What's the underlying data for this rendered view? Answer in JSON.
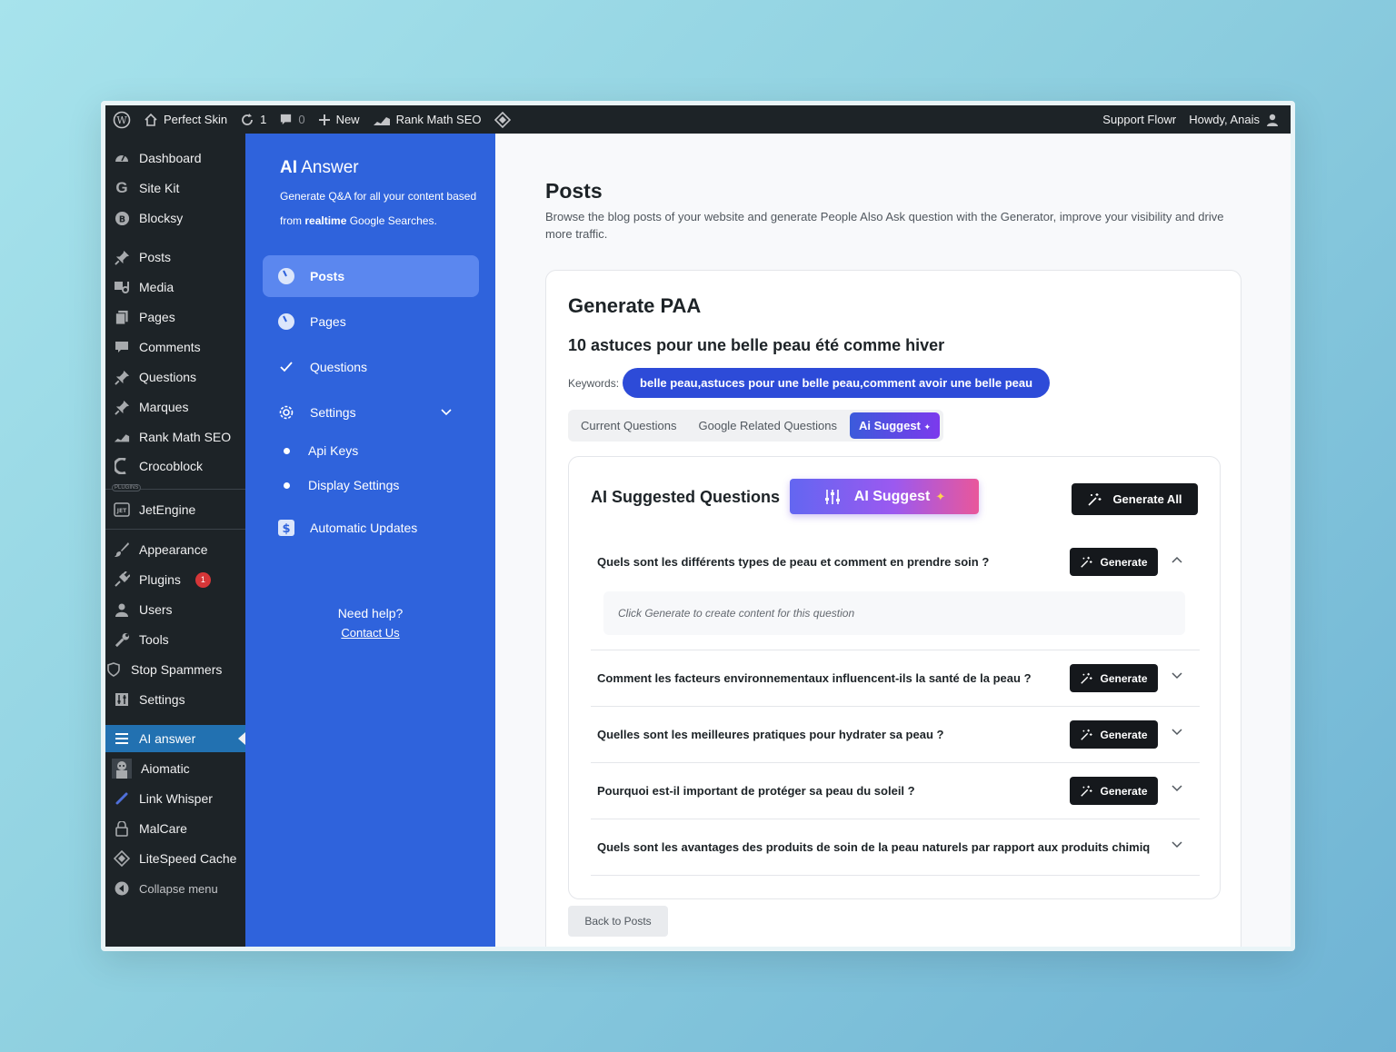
{
  "adminbar": {
    "site_name": "Perfect Skin",
    "updates_count": "1",
    "comments_count": "0",
    "new_label": "New",
    "rankmath_label": "Rank Math SEO",
    "support_label": "Support Flowr",
    "howdy_label": "Howdy, Anais"
  },
  "wp_menu": {
    "dashboard": "Dashboard",
    "site_kit": "Site Kit",
    "blocksy": "Blocksy",
    "posts": "Posts",
    "media": "Media",
    "pages": "Pages",
    "comments": "Comments",
    "questions": "Questions",
    "marques": "Marques",
    "rank_math": "Rank Math SEO",
    "crocoblock": "Crocoblock",
    "plugins_tag": "PLUGINS",
    "jetengine": "JetEngine",
    "appearance": "Appearance",
    "plugins": "Plugins",
    "plugins_badge": "1",
    "users": "Users",
    "tools": "Tools",
    "stop_spammers": "Stop Spammers",
    "settings": "Settings",
    "ai_answer": "AI answer",
    "aiomatic": "Aiomatic",
    "link_whisper": "Link Whisper",
    "malcare": "MalCare",
    "litespeed": "LiteSpeed Cache",
    "collapse": "Collapse menu"
  },
  "plugin_side": {
    "title_ai": "AI",
    "title_rest": "Answer",
    "desc_part1": "Generate Q&A for all your content based from",
    "desc_bold": "realtime",
    "desc_part2": "Google Searches.",
    "posts": "Posts",
    "pages": "Pages",
    "questions": "Questions",
    "settings": "Settings",
    "api_keys": "Api Keys",
    "display_settings": "Display Settings",
    "automatic_updates": "Automatic Updates",
    "need_help": "Need help?",
    "contact": "Contact Us"
  },
  "main": {
    "title": "Posts",
    "description": "Browse the blog posts of your website and generate People Also Ask question with the Generator, improve your visibility and drive more traffic.",
    "card_title": "Generate PAA",
    "post_title": "10 astuces pour une belle peau été comme hiver",
    "keywords_label": "Keywords:",
    "keywords_value": "belle peau,astuces pour une belle peau,comment avoir une belle peau",
    "tabs": [
      "Current Questions",
      "Google Related Questions",
      "Ai Suggest"
    ],
    "inner_title": "AI Suggested Questions",
    "ai_suggest_button": "AI Suggest",
    "generate_all": "Generate All",
    "generate_label": "Generate",
    "placeholder": "Click Generate to create content for this question",
    "questions": [
      "Quels sont les différents types de peau et comment en prendre soin ?",
      "Comment les facteurs environnementaux influencent-ils la santé de la peau ?",
      "Quelles sont les meilleures pratiques pour hydrater sa peau ?",
      "Pourquoi est-il important de protéger sa peau du soleil ?",
      "Quels sont les avantages des produits de soin de la peau naturels par rapport aux produits chimiq"
    ],
    "back_button": "Back to Posts"
  },
  "colors": {
    "wp_dark": "#1d2327",
    "wp_active": "#2271b1",
    "plugin_blue": "#2f63dc",
    "keyword_pill": "#2d4bd8"
  }
}
